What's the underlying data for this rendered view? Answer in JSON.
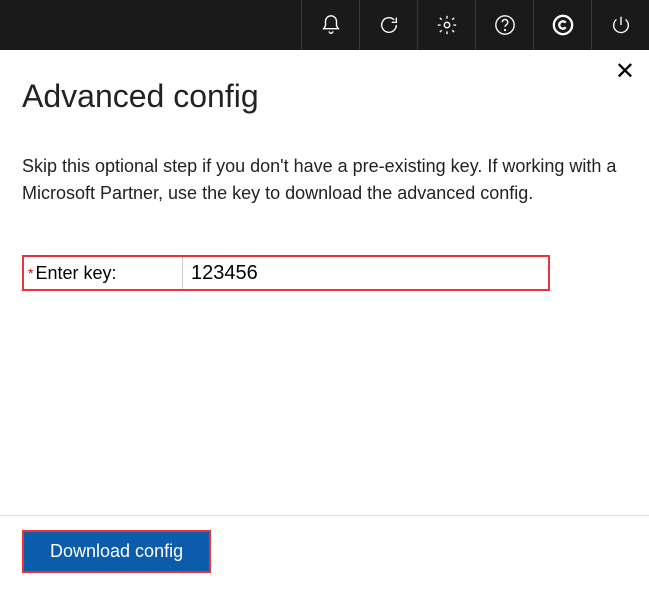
{
  "topbar": {
    "icons": [
      "bell-icon",
      "refresh-icon",
      "gear-icon",
      "help-icon",
      "copyright-icon",
      "power-icon"
    ]
  },
  "dialog": {
    "title": "Advanced config",
    "description": "Skip this optional step if you don't have a pre-existing key. If working with a Microsoft Partner, use the key to download the advanced config.",
    "close_glyph": "✕",
    "field": {
      "required_mark": "*",
      "label": "Enter key:",
      "value": "123456"
    },
    "download_label": "Download config"
  }
}
